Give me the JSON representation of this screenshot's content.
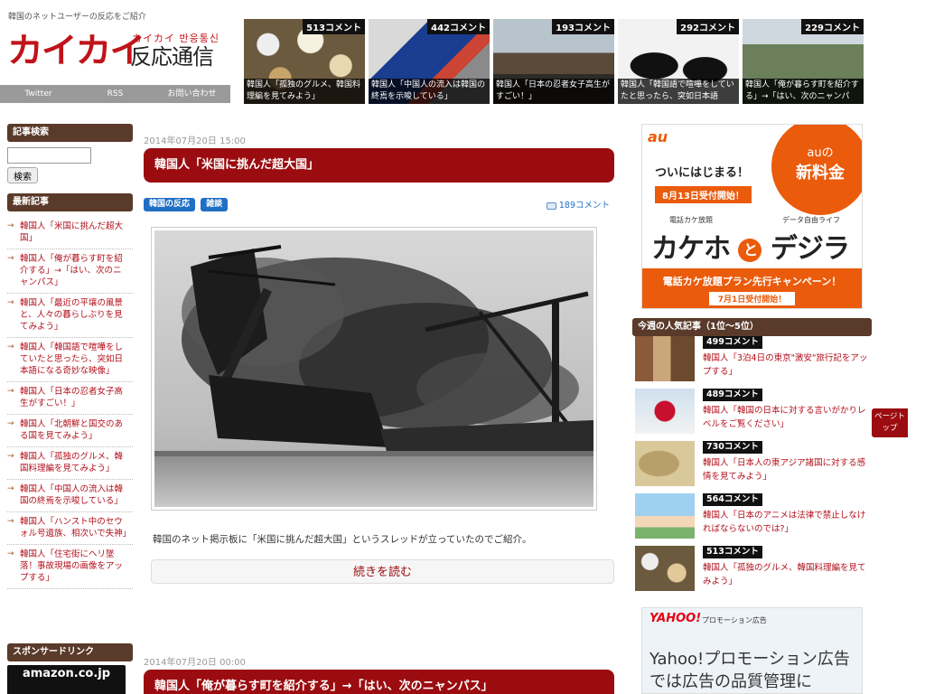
{
  "site": {
    "tagline": "韓国のネットユーザーの反応をご紹介",
    "logo_main": "カイカイ",
    "logo_kana_hangul": "カイカイ 반응통신",
    "logo_sub": "反応通信"
  },
  "topnav": [
    "Twitter",
    "RSS",
    "お問い合わせ"
  ],
  "thumbs": [
    {
      "count": "513コメント",
      "caption": "韓国人「孤独のグルメ、韓国料理編を見てみよう」"
    },
    {
      "count": "442コメント",
      "caption": "韓国人「中国人の流入は韓国の終焉を示唆している」"
    },
    {
      "count": "193コメント",
      "caption": "韓国人「日本の忍者女子高生がすごい！」"
    },
    {
      "count": "292コメント",
      "caption": "韓国人「韓国語で喧嘩をしていたと思ったら、突如日本語"
    },
    {
      "count": "229コメント",
      "caption": "韓国人「俺が暮らす町を紹介する」→「はい、次のニャンパ"
    }
  ],
  "sidebar": {
    "search_head": "記事検索",
    "search_button": "検索",
    "latest_head": "最新記事",
    "latest": [
      "韓国人「米国に挑んだ超大国」",
      "韓国人「俺が暮らす町を紹介する」→「はい、次のニャンパス」",
      "韓国人「最近の平壌の風景と、人々の暮らしぶりを見てみよう」",
      "韓国人「韓国語で喧嘩をしていたと思ったら、突如日本語になる奇妙な映像」",
      "韓国人「日本の忍者女子高生がすごい！」",
      "韓国人「北朝鮮と国交のある国を見てみよう」",
      "韓国人「孤独のグルメ、韓国料理編を見てみよう」",
      "韓国人「中国人の流入は韓国の終焉を示唆している」",
      "韓国人「ハンスト中のセウォル号遺族、相次いで失神」",
      "韓国人「住宅街にヘリ墜落！事故現場の画像をアップする」"
    ],
    "sponsor_head": "スポンサードリンク",
    "amazon": "amazon.co.jp"
  },
  "posts": [
    {
      "date": "2014年07月20日 15:00",
      "title": "韓国人「米国に挑んだ超大国」",
      "tags": [
        "韓国の反応",
        "雑談"
      ],
      "comments": "189コメント",
      "excerpt": "韓国のネット掲示板に「米国に挑んだ超大国」というスレッドが立っていたのでご紹介。",
      "more": "続きを読む"
    },
    {
      "date": "2014年07月20日 00:00",
      "title": "韓国人「俺が暮らす町を紹介する」→「はい、次のニャンパス」"
    }
  ],
  "ad_au": {
    "brand": "au",
    "burst_small": "auの",
    "burst_big": "新料金",
    "line1": "ついにはじまる！",
    "line2": "8月13日受付開始！",
    "tag_left": "電話カケ放題",
    "tag_right": "データ自由ライフ",
    "big_left": "カケホ",
    "big_mid": "と",
    "big_right": "デジラ",
    "foot1": "電話カケ放題プラン先行キャンペーン！",
    "foot2": "7月1日受付開始！"
  },
  "popular": {
    "head": "今週の人気記事（1位〜5位）",
    "items": [
      {
        "count": "499コメント",
        "title": "韓国人「3泊4日の東京\"激安\"旅行記をアップする」"
      },
      {
        "count": "489コメント",
        "title": "韓国人「韓国の日本に対する言いがかりレベルをご覧ください」"
      },
      {
        "count": "730コメント",
        "title": "韓国人「日本人の東アジア諸国に対する感情を見てみよう」"
      },
      {
        "count": "564コメント",
        "title": "韓国人「日本のアニメは法律で禁止しなければならないのでは?」"
      },
      {
        "count": "513コメント",
        "title": "韓国人「孤独のグルメ、韓国料理編を見てみよう」"
      }
    ]
  },
  "ad_yahoo": {
    "logo": "YAHOO!",
    "label": "プロモーション広告",
    "text": "Yahoo!プロモーション広告では広告の品質管理に"
  },
  "pagetop": "ページトップ"
}
